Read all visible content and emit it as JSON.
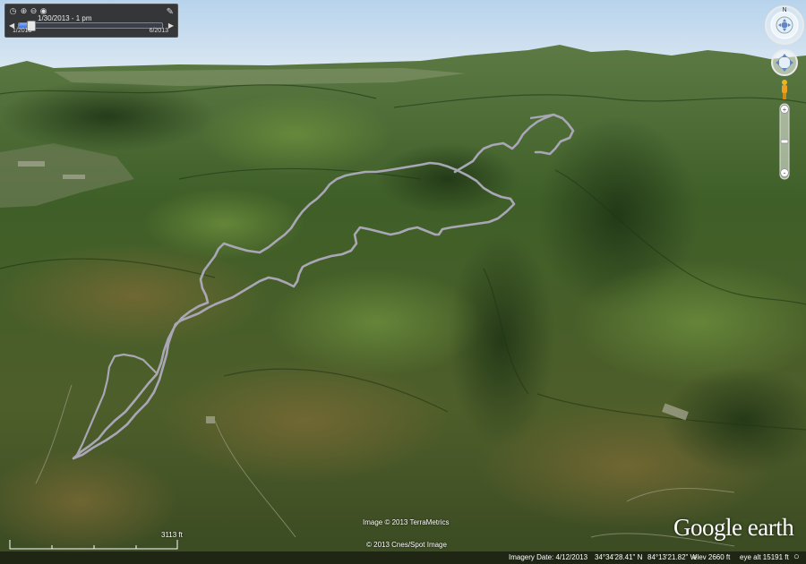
{
  "time_slider": {
    "current": "1/30/2013 - 1 pm",
    "start": "1/2013",
    "end": "6/2013",
    "progress": 0.08
  },
  "credits": {
    "imagery_1": "Image © 2013 TerraMetrics",
    "imagery_2": "© 2013 Cnes/Spot Image",
    "logo": "Google earth"
  },
  "scale_bar": {
    "label": "3113 ft"
  },
  "status_bar": {
    "imagery_date": "Imagery Date: 4/12/2013",
    "latitude": "34°34'28.41\" N",
    "longitude": "84°13'21.82\" W",
    "elevation": "elev  2660 ft",
    "eye_altitude": "eye alt  15191 ft"
  },
  "icons": [
    "clock-icon",
    "zoom-in-icon",
    "zoom-out-icon",
    "eye-icon",
    "wrench-icon",
    "play-icon",
    "next-icon",
    "compass-icon",
    "look-joystick-icon",
    "move-joystick-icon",
    "pegman-icon",
    "zoom-plus-icon",
    "zoom-minus-icon",
    "streaming-icon"
  ],
  "colors": {
    "track": "#a9a6b5",
    "forest": "#4d6b2c",
    "sky": "#c9dff0"
  }
}
